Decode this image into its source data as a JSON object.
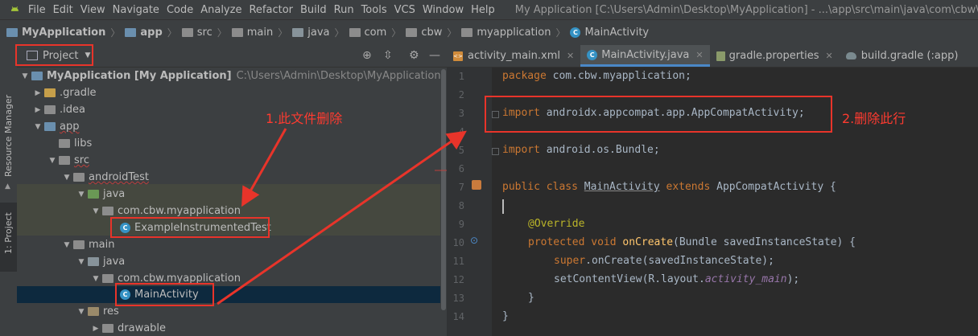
{
  "window": {
    "title": "My Application [C:\\Users\\Admin\\Desktop\\MyApplication] - ...\\app\\src\\main\\java\\com\\cbw\\myappli",
    "menu": [
      "File",
      "Edit",
      "View",
      "Navigate",
      "Code",
      "Analyze",
      "Refactor",
      "Build",
      "Run",
      "Tools",
      "VCS",
      "Window",
      "Help"
    ]
  },
  "breadcrumb": [
    "MyApplication",
    "app",
    "src",
    "main",
    "java",
    "com",
    "cbw",
    "myapplication",
    "MainActivity"
  ],
  "side_tabs": {
    "resource_manager": "Resource Manager",
    "project": "1: Project"
  },
  "project_panel": {
    "view_mode": "Project"
  },
  "tree": [
    {
      "label": "MyApplication [My Application]",
      "path": "C:\\Users\\Admin\\Desktop\\MyApplication",
      "depth": 0,
      "icon": "module",
      "expanded": true
    },
    {
      "label": ".gradle",
      "depth": 1,
      "icon": "folder",
      "expanded": false
    },
    {
      "label": ".idea",
      "depth": 1,
      "icon": "folder",
      "expanded": false
    },
    {
      "label": "app",
      "depth": 1,
      "icon": "module",
      "expanded": true
    },
    {
      "label": "libs",
      "depth": 2,
      "icon": "folder"
    },
    {
      "label": "src",
      "depth": 2,
      "icon": "folder",
      "expanded": true
    },
    {
      "label": "androidTest",
      "depth": 3,
      "icon": "folder",
      "expanded": true
    },
    {
      "label": "java",
      "depth": 4,
      "icon": "folder-green",
      "expanded": true
    },
    {
      "label": "com.cbw.myapplication",
      "depth": 5,
      "icon": "package",
      "expanded": true
    },
    {
      "label": "ExampleInstrumentedTest",
      "depth": 6,
      "icon": "class"
    },
    {
      "label": "main",
      "depth": 3,
      "icon": "folder",
      "expanded": true
    },
    {
      "label": "java",
      "depth": 4,
      "icon": "folder-blue",
      "expanded": true
    },
    {
      "label": "com.cbw.myapplication",
      "depth": 5,
      "icon": "package",
      "expanded": true
    },
    {
      "label": "MainActivity",
      "depth": 6,
      "icon": "class"
    },
    {
      "label": "res",
      "depth": 4,
      "icon": "folder-res",
      "expanded": true
    },
    {
      "label": "drawable",
      "depth": 5,
      "icon": "folder",
      "expanded": false
    }
  ],
  "tabs": [
    {
      "label": "activity_main.xml",
      "icon": "xml-file-icon"
    },
    {
      "label": "MainActivity.java",
      "icon": "class-icon",
      "active": true
    },
    {
      "label": "gradle.properties",
      "icon": "properties-icon"
    },
    {
      "label": "build.gradle (:app)",
      "icon": "gradle-icon"
    }
  ],
  "line_numbers": [
    "1",
    "2",
    "3",
    "4",
    "5",
    "6",
    "7",
    "8",
    "9",
    "10",
    "11",
    "12",
    "13",
    "14"
  ],
  "code": {
    "l1_kw": "package",
    "l1_rest": " com.cbw.myapplication;",
    "l3_kw": "import",
    "l3_rest": " androidx.appcompat.app.AppCompatActivity;",
    "l5_kw": "import",
    "l5_rest": " android.os.Bundle;",
    "l7_kw": "public class",
    "l7_name": "MainActivity",
    "l7_kw2": "extends",
    "l7_rest": " AppCompatActivity {",
    "l9_an": "@Override",
    "l10_kw": "protected void",
    "l10_fn": "onCreate",
    "l10_rest": "(Bundle savedInstanceState) {",
    "l11_kw": "super",
    "l11_rest": ".onCreate(savedInstanceState);",
    "l12_a": "setContentView(R.layout.",
    "l12_it": "activity_main",
    "l12_b": ");",
    "l13": "}",
    "l14": "}"
  },
  "annotations": {
    "note1": "1.此文件删除",
    "note2": "2.删除此行"
  },
  "colors": {
    "annotation_red": "#e8342a",
    "keyword": "#cc7832",
    "annotation_code": "#bbb529",
    "method": "#ffc66d",
    "field_italic": "#9876aa"
  }
}
